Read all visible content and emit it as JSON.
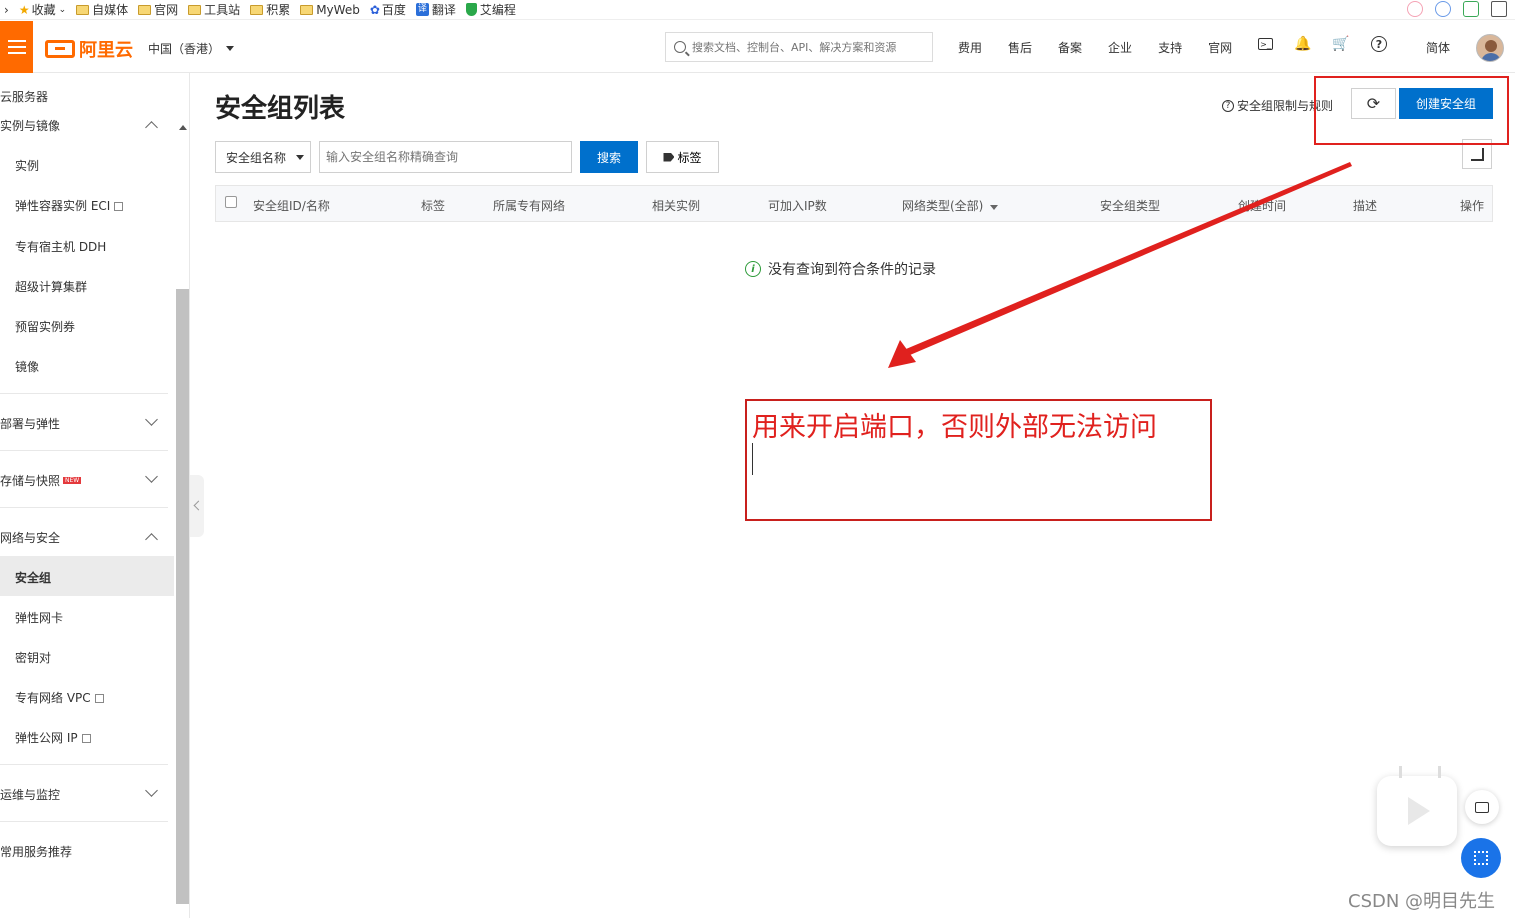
{
  "bookmarks": [
    "收藏",
    "自媒体",
    "官网",
    "工具站",
    "积累",
    "MyWeb",
    "百度",
    "翻译",
    "艾编程"
  ],
  "header": {
    "logo": "阿里云",
    "region": "中国（香港）",
    "search_placeholder": "搜索文档、控制台、API、解决方案和资源",
    "links": [
      "费用",
      "售后",
      "备案",
      "企业",
      "支持",
      "官网"
    ],
    "lang": "简体"
  },
  "sidebar": {
    "title": "云服务器",
    "group_instances": "实例与镜像",
    "items_instances": [
      "实例",
      "弹性容器实例 ECI",
      "专有宿主机 DDH",
      "超级计算集群",
      "预留实例券",
      "镜像"
    ],
    "group_deploy": "部署与弹性",
    "group_storage": "存储与快照",
    "new_badge": "NEW",
    "group_network": "网络与安全",
    "items_network": [
      "安全组",
      "弹性网卡",
      "密钥对",
      "专有网络 VPC",
      "弹性公网 IP"
    ],
    "group_ops": "运维与监控",
    "group_recommend": "常用服务推荐"
  },
  "main": {
    "title": "安全组列表",
    "rules_link": "安全组限制与规则",
    "create_button": "创建安全组",
    "filter_select": "安全组名称",
    "filter_placeholder": "输入安全组名称精确查询",
    "search_button": "搜索",
    "tag_button": "标签",
    "columns": [
      "安全组ID/名称",
      "标签",
      "所属专有网络",
      "相关实例",
      "可加入IP数",
      "网络类型(全部)",
      "安全组类型",
      "创建时间",
      "描述",
      "操作"
    ],
    "empty_text": "没有查询到符合条件的记录"
  },
  "annotation": {
    "text": "用来开启端口，否则外部无法访问",
    "color": "#e0211e"
  },
  "watermark": "CSDN @明目先生",
  "colors": {
    "brand": "#ff6a00",
    "primary": "#0070cc"
  }
}
